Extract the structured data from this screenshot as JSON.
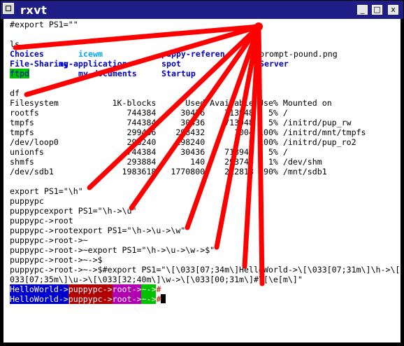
{
  "window": {
    "title": "rxvt",
    "buttons": [
      "_",
      "□",
      "x"
    ]
  },
  "terminal": {
    "export_cmd_1": "#export PS1=\"\"",
    "ls_cmd": "ls",
    "ls_rows": [
      [
        "Choices",
        "icewm",
        "puppy-referen",
        "prompt-pound.png"
      ],
      [
        "File-Sharing",
        "my-applications",
        "spot",
        "-Server"
      ],
      [
        "ftpd",
        "my-documents",
        "Startup",
        ""
      ]
    ],
    "df_cmd": "df",
    "df_header": "Filesystem           1K-blocks      Used Available Use% Mounted on",
    "df_rows": [
      "rootfs                  744384     30436    713948   5% /",
      "tmpfs                   744384     30436    713948   5% /initrd/pup_rw",
      "tmpfs                   299436    298432      1004 100% /initrd/mnt/tmpfs",
      "/dev/loop0              298240    298240         0 100% /initrd/pup_ro2",
      "unionfs                 744384     30436    713948   5% /",
      "shmfs                   293884       140    293744   1% /dev/shm",
      "/dev/sdb1              1983618   1770800    212818  90% /mnt/sdb1"
    ],
    "history": [
      "export PS1=\"\\h\"",
      "puppypc",
      "puppypcexport PS1=\"\\h->\\u\"",
      "puppypc->root",
      "puppypc->rootexport PS1=\"\\h->\\u->\\w\"",
      "puppypc->root->~",
      "puppypc->root->~export PS1=\"\\h->\\u->\\w->$\"",
      "puppypc->root->~->$",
      "puppypc->root->~->$#export PS1=\"\\[\\033[07;34m\\]HelloWorld->\\[\\033[07;31m\\]\\h->\\[\\",
      "033[07;35m\\]\\u->\\[\\033[32;40m\\]\\w->\\[\\033[00;31m\\]#\\[\\e[m\\]\""
    ],
    "prompt_parts": [
      "HelloWorld->",
      "puppypc->",
      "root->",
      "~->",
      "#"
    ]
  },
  "annotation": {
    "color": "#ff0000"
  }
}
